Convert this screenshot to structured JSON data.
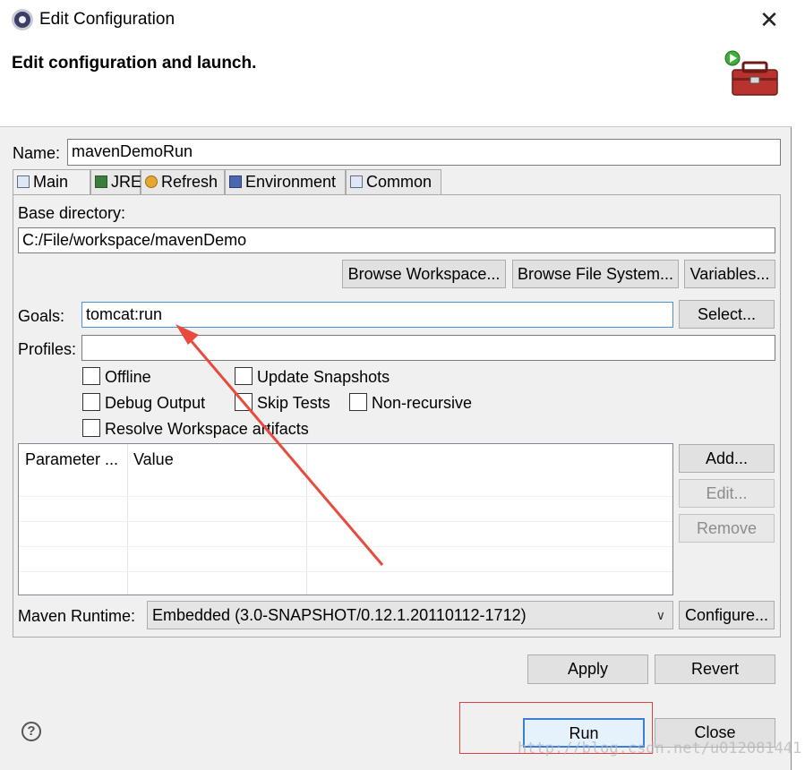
{
  "window": {
    "title": "Edit Configuration",
    "close_glyph": "✕"
  },
  "banner": {
    "title": "Edit configuration and launch."
  },
  "name": {
    "label": "Name:",
    "value": "mavenDemoRun"
  },
  "tabs": [
    {
      "label": "Main",
      "icon": "main-tab-icon",
      "active": true
    },
    {
      "label": "JRE",
      "icon": "jre-icon"
    },
    {
      "label": "Refresh",
      "icon": "refresh-icon"
    },
    {
      "label": "Environment",
      "icon": "environment-icon"
    },
    {
      "label": "Common",
      "icon": "common-icon"
    }
  ],
  "main": {
    "base_dir_label": "Base directory:",
    "base_dir_value": "C:/File/workspace/mavenDemo",
    "browse_workspace": "Browse Workspace...",
    "browse_file_system": "Browse File System...",
    "variables": "Variables...",
    "goals_label": "Goals:",
    "goals_value": "tomcat:run",
    "select": "Select...",
    "profiles_label": "Profiles:",
    "profiles_value": "",
    "checkboxes": {
      "offline": "Offline",
      "update_snapshots": "Update Snapshots",
      "debug_output": "Debug Output",
      "skip_tests": "Skip Tests",
      "non_recursive": "Non-recursive",
      "resolve_workspace": "Resolve Workspace artifacts"
    },
    "table": {
      "col_parameter": "Parameter ...",
      "col_value": "Value"
    },
    "add": "Add...",
    "edit": "Edit...",
    "remove": "Remove",
    "runtime_label": "Maven Runtime:",
    "runtime_value": "Embedded (3.0-SNAPSHOT/0.12.1.20110112-1712)",
    "configure": "Configure..."
  },
  "footer": {
    "apply": "Apply",
    "revert": "Revert",
    "run": "Run",
    "close": "Close",
    "help_glyph": "?",
    "watermark": "http://blog.csdn.net/u012081441"
  },
  "colors": {
    "annotation": "#e84b3c",
    "focus": "#4a90d9"
  }
}
